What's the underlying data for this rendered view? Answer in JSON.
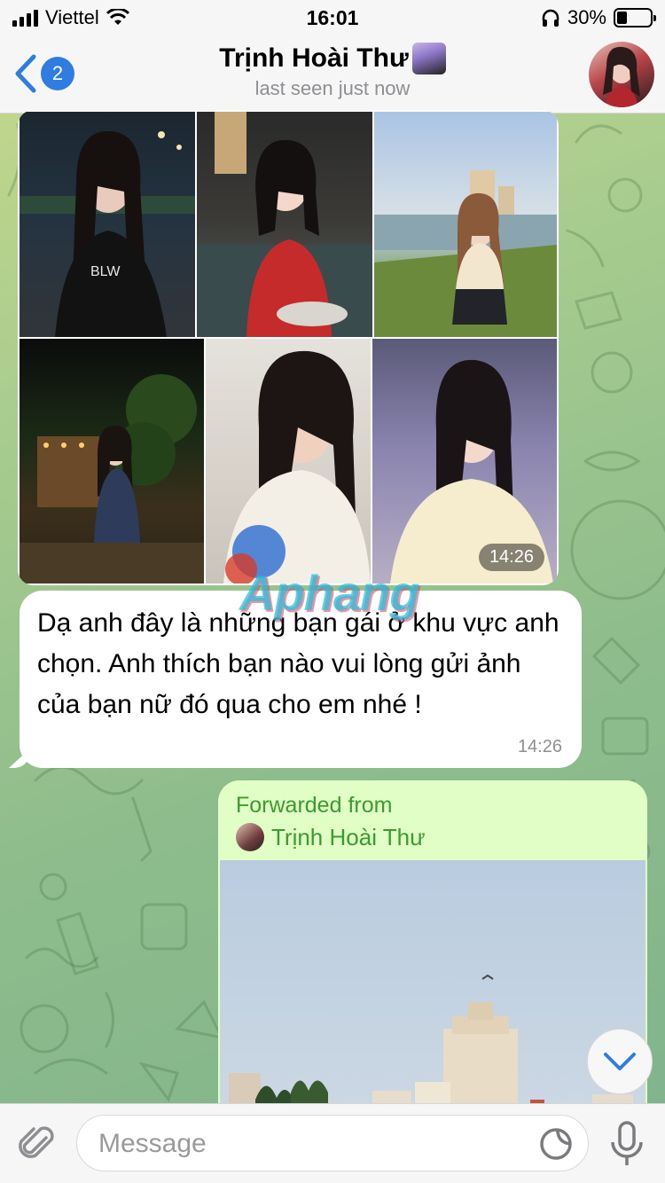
{
  "status_bar": {
    "carrier": "Viettel",
    "time": "16:01",
    "battery": "30%",
    "battery_level": 0.3,
    "icons": [
      "signal-icon",
      "wifi-icon",
      "headphones-icon",
      "battery-icon"
    ]
  },
  "header": {
    "back_icon": "chevron-left-icon",
    "unread_count": "2",
    "contact_name": "Trịnh Hoài Thư",
    "status": "last seen just now"
  },
  "album": {
    "time": "14:26",
    "photos": [
      "photo-1",
      "photo-2",
      "photo-3",
      "photo-4",
      "photo-5",
      "photo-6"
    ]
  },
  "message_in": {
    "text": "Dạ anh đây là những bạn gái ở khu vực anh chọn. Anh thích bạn nào vui lòng gửi ảnh của bạn nữ đó qua cho em nhé !",
    "time": "14:26"
  },
  "watermark": "Aphang",
  "forwarded": {
    "label": "Forwarded from",
    "from_name": "Trịnh Hoài Thư"
  },
  "input": {
    "placeholder": "Message",
    "attach_icon": "paperclip-icon",
    "sticker_icon": "sticker-icon",
    "mic_icon": "microphone-icon"
  },
  "scroll_icon": "chevron-down-icon",
  "colors": {
    "accent": "#2f7de1",
    "forward_green": "#3a9c2c",
    "outgoing_bubble": "#e1fec6",
    "incoming_bubble": "#ffffff"
  }
}
